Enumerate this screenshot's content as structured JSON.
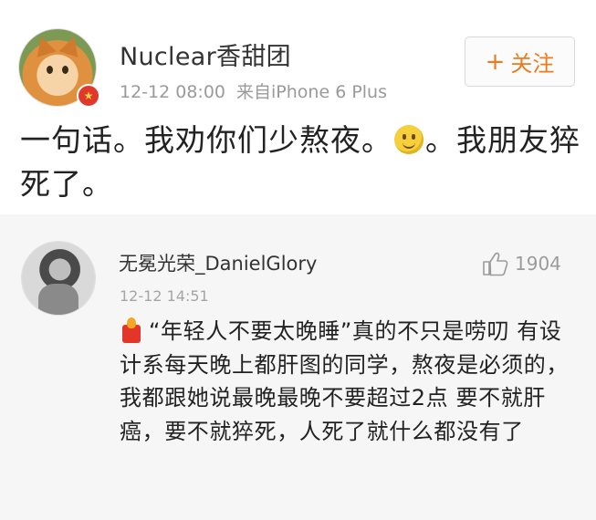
{
  "post": {
    "username": "Nuclear香甜团",
    "timestamp": "12-12 08:00",
    "source": "来自iPhone 6 Plus",
    "follow_label": "关注",
    "text_part1": "一句话。我劝你们少熬夜。",
    "text_part2": "。我朋友猝死了。",
    "emoji": "smile-emoji",
    "badge_icon": "vip-badge-icon"
  },
  "comment": {
    "username": "无冕光荣_DanielGlory",
    "timestamp": "12-12 14:51",
    "likes": "1904",
    "text": "“年轻人不要太晚睡”真的不只是唠叨 有设计系每天晚上都肝图的同学，熬夜是必须的，我都跟她说最晚最晚不要超过2点 要不就肝癌，要不就猝死，人死了就什么都没有了",
    "emoji": "fire-cup-emoji",
    "like_icon": "thumbs-up-icon"
  },
  "colors": {
    "follow_accent": "#ee7a1e",
    "muted_text": "#9a9a9a",
    "comment_bg": "#f6f6f6"
  }
}
